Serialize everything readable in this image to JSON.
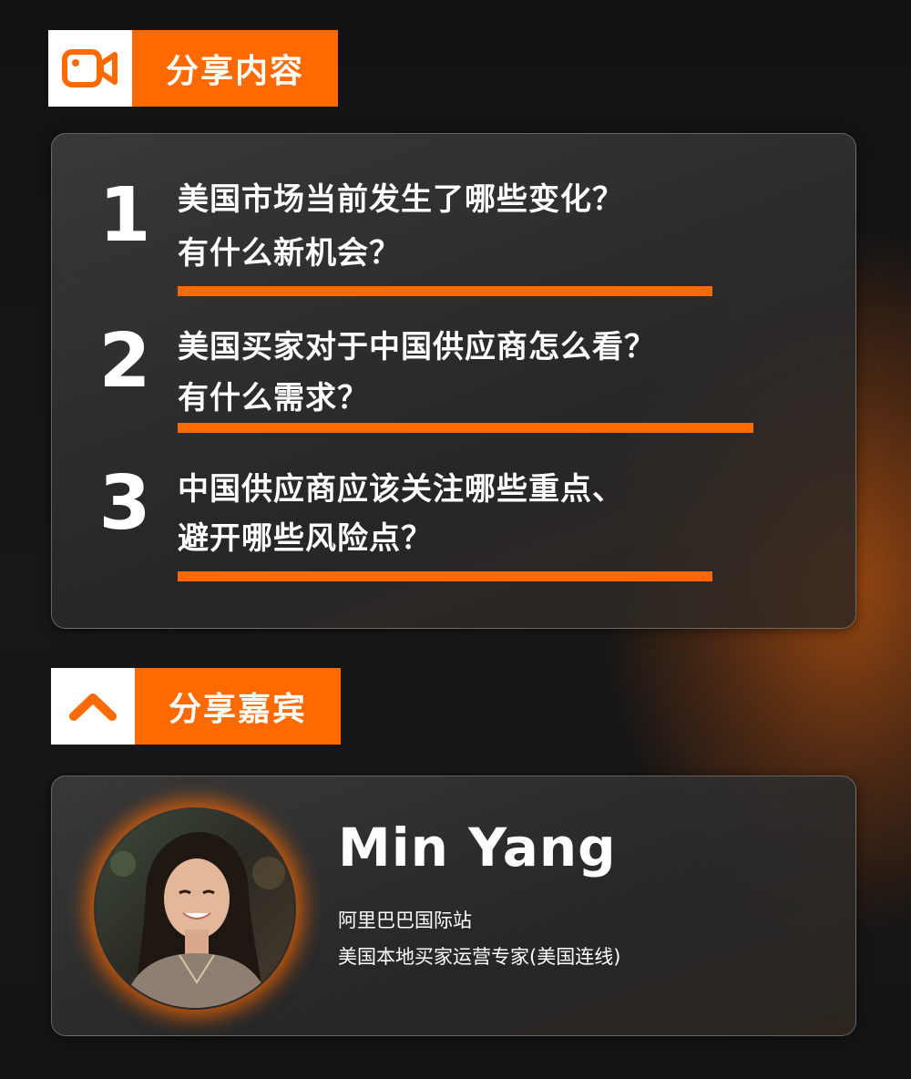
{
  "sections": {
    "topics_header": {
      "icon": "video-camera-icon",
      "label": "分享内容"
    },
    "speaker_header": {
      "icon": "chevron-up-icon",
      "label": "分享嘉宾"
    }
  },
  "topics": [
    {
      "number": "1",
      "line1": "美国市场当前发生了哪些变化？",
      "line2": "有什么新机会？"
    },
    {
      "number": "2",
      "line1": "美国买家对于中国供应商怎么看？",
      "line2": "有什么需求？"
    },
    {
      "number": "3",
      "line1": "中国供应商应该关注哪些重点、",
      "line2": "避开哪些风险点？"
    }
  ],
  "speaker": {
    "name": "Min Yang",
    "organization": "阿里巴巴国际站",
    "role": "美国本地买家运营专家(美国连线)"
  },
  "colors": {
    "accent": "#ff6a00",
    "background": "#151515",
    "card": "#3a3a3a"
  }
}
